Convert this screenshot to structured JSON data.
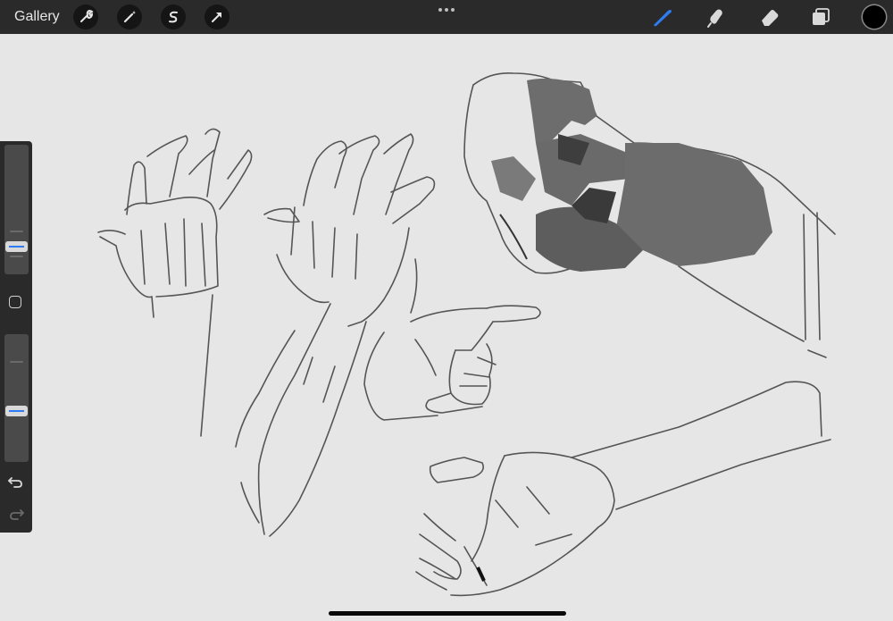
{
  "toolbar": {
    "gallery_label": "Gallery",
    "left_tools": [
      "wrench-icon",
      "magic-wand-icon",
      "selection-icon",
      "transform-arrow-icon"
    ],
    "right_tools": [
      "brush-icon",
      "smudge-icon",
      "eraser-icon",
      "layers-icon"
    ],
    "active_tool": "brush",
    "accent_color": "#2f7bf0",
    "current_color": "#000000"
  },
  "sidebar": {
    "brush_size": 0.22,
    "opacity": 0.42,
    "controls": [
      "brush-size-slider",
      "modify-button",
      "opacity-slider",
      "undo-button",
      "redo-button"
    ]
  },
  "canvas": {
    "background": "#e7e6e6",
    "content": "hand-sketches"
  }
}
